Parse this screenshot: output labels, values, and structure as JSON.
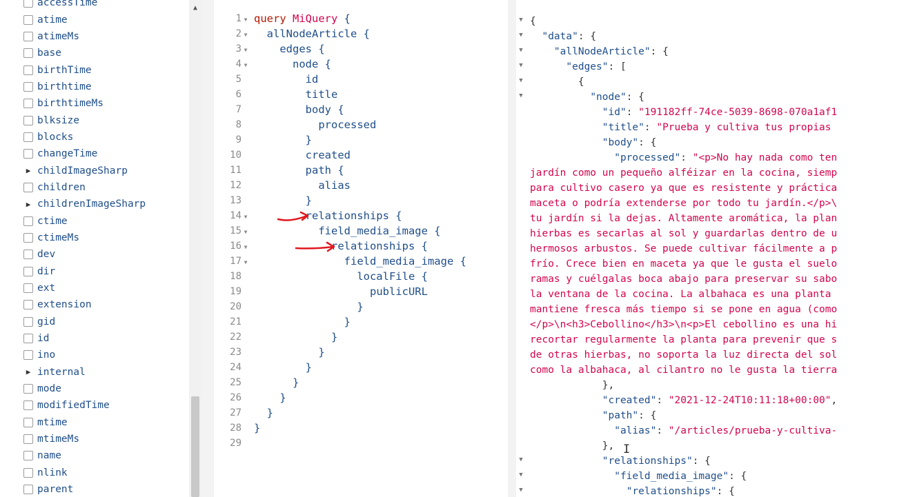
{
  "explorer": {
    "fields": [
      {
        "label": "accessTime",
        "expandable": false
      },
      {
        "label": "atime",
        "expandable": false
      },
      {
        "label": "atimeMs",
        "expandable": false
      },
      {
        "label": "base",
        "expandable": false
      },
      {
        "label": "birthTime",
        "expandable": false
      },
      {
        "label": "birthtime",
        "expandable": false
      },
      {
        "label": "birthtimeMs",
        "expandable": false
      },
      {
        "label": "blksize",
        "expandable": false
      },
      {
        "label": "blocks",
        "expandable": false
      },
      {
        "label": "changeTime",
        "expandable": false
      },
      {
        "label": "childImageSharp",
        "expandable": true
      },
      {
        "label": "children",
        "expandable": false
      },
      {
        "label": "childrenImageSharp",
        "expandable": true
      },
      {
        "label": "ctime",
        "expandable": false
      },
      {
        "label": "ctimeMs",
        "expandable": false
      },
      {
        "label": "dev",
        "expandable": false
      },
      {
        "label": "dir",
        "expandable": false
      },
      {
        "label": "ext",
        "expandable": false
      },
      {
        "label": "extension",
        "expandable": false
      },
      {
        "label": "gid",
        "expandable": false
      },
      {
        "label": "id",
        "expandable": false
      },
      {
        "label": "ino",
        "expandable": false
      },
      {
        "label": "internal",
        "expandable": true
      },
      {
        "label": "mode",
        "expandable": false
      },
      {
        "label": "modifiedTime",
        "expandable": false
      },
      {
        "label": "mtime",
        "expandable": false
      },
      {
        "label": "mtimeMs",
        "expandable": false
      },
      {
        "label": "name",
        "expandable": false
      },
      {
        "label": "nlink",
        "expandable": false
      },
      {
        "label": "parent",
        "expandable": false
      }
    ]
  },
  "query": {
    "line_numbers": [
      "1",
      "2",
      "3",
      "4",
      "5",
      "6",
      "7",
      "8",
      "9",
      "10",
      "11",
      "12",
      "13",
      "14",
      "15",
      "16",
      "17",
      "18",
      "19",
      "20",
      "21",
      "22",
      "23",
      "24",
      "25",
      "26",
      "27",
      "28",
      "29"
    ],
    "lines": [
      {
        "indent": "",
        "parts": [
          {
            "t": "query ",
            "c": "kw"
          },
          {
            "t": "MiQuery",
            "c": "op"
          },
          {
            "t": " {",
            "c": ""
          }
        ]
      },
      {
        "indent": "  ",
        "parts": [
          {
            "t": "allNodeArticle {",
            "c": ""
          }
        ]
      },
      {
        "indent": "    ",
        "parts": [
          {
            "t": "edges {",
            "c": ""
          }
        ]
      },
      {
        "indent": "      ",
        "parts": [
          {
            "t": "node {",
            "c": ""
          }
        ]
      },
      {
        "indent": "        ",
        "parts": [
          {
            "t": "id",
            "c": ""
          }
        ]
      },
      {
        "indent": "        ",
        "parts": [
          {
            "t": "title",
            "c": ""
          }
        ]
      },
      {
        "indent": "        ",
        "parts": [
          {
            "t": "body {",
            "c": ""
          }
        ]
      },
      {
        "indent": "          ",
        "parts": [
          {
            "t": "processed",
            "c": ""
          }
        ]
      },
      {
        "indent": "        ",
        "parts": [
          {
            "t": "}",
            "c": ""
          }
        ]
      },
      {
        "indent": "        ",
        "parts": [
          {
            "t": "created",
            "c": ""
          }
        ]
      },
      {
        "indent": "        ",
        "parts": [
          {
            "t": "path {",
            "c": ""
          }
        ]
      },
      {
        "indent": "          ",
        "parts": [
          {
            "t": "alias",
            "c": ""
          }
        ]
      },
      {
        "indent": "        ",
        "parts": [
          {
            "t": "}",
            "c": ""
          }
        ]
      },
      {
        "indent": "        ",
        "parts": [
          {
            "t": "relationships {",
            "c": ""
          }
        ]
      },
      {
        "indent": "          ",
        "parts": [
          {
            "t": "field_media_image {",
            "c": ""
          }
        ]
      },
      {
        "indent": "            ",
        "parts": [
          {
            "t": "relationships {",
            "c": ""
          }
        ]
      },
      {
        "indent": "              ",
        "parts": [
          {
            "t": "field_media_image {",
            "c": ""
          }
        ]
      },
      {
        "indent": "                ",
        "parts": [
          {
            "t": "localFile {",
            "c": ""
          }
        ]
      },
      {
        "indent": "                  ",
        "parts": [
          {
            "t": "publicURL",
            "c": ""
          }
        ]
      },
      {
        "indent": "                ",
        "parts": [
          {
            "t": "}",
            "c": ""
          }
        ]
      },
      {
        "indent": "              ",
        "parts": [
          {
            "t": "}",
            "c": ""
          }
        ]
      },
      {
        "indent": "            ",
        "parts": [
          {
            "t": "}",
            "c": ""
          }
        ]
      },
      {
        "indent": "          ",
        "parts": [
          {
            "t": "}",
            "c": ""
          }
        ]
      },
      {
        "indent": "        ",
        "parts": [
          {
            "t": "}",
            "c": ""
          }
        ]
      },
      {
        "indent": "      ",
        "parts": [
          {
            "t": "}",
            "c": ""
          }
        ]
      },
      {
        "indent": "    ",
        "parts": [
          {
            "t": "}",
            "c": ""
          }
        ]
      },
      {
        "indent": "  ",
        "parts": [
          {
            "t": "}",
            "c": ""
          }
        ]
      },
      {
        "indent": "",
        "parts": [
          {
            "t": "}",
            "c": ""
          }
        ]
      },
      {
        "indent": "",
        "parts": []
      }
    ],
    "fold_lines": [
      "1",
      "2",
      "3",
      "4",
      "14",
      "15",
      "16",
      "17"
    ],
    "annotated_lines": [
      "14",
      "16"
    ]
  },
  "result": {
    "lines": [
      {
        "indent": "",
        "parts": [
          {
            "t": "{",
            "c": "p"
          }
        ]
      },
      {
        "indent": "  ",
        "parts": [
          {
            "t": "\"data\"",
            "c": "k"
          },
          {
            "t": ": {",
            "c": "p"
          }
        ]
      },
      {
        "indent": "    ",
        "parts": [
          {
            "t": "\"allNodeArticle\"",
            "c": "k"
          },
          {
            "t": ": {",
            "c": "p"
          }
        ]
      },
      {
        "indent": "      ",
        "parts": [
          {
            "t": "\"edges\"",
            "c": "k"
          },
          {
            "t": ": [",
            "c": "p"
          }
        ]
      },
      {
        "indent": "        ",
        "parts": [
          {
            "t": "{",
            "c": "p"
          }
        ]
      },
      {
        "indent": "          ",
        "parts": [
          {
            "t": "\"node\"",
            "c": "k"
          },
          {
            "t": ": {",
            "c": "p"
          }
        ]
      },
      {
        "indent": "            ",
        "parts": [
          {
            "t": "\"id\"",
            "c": "k"
          },
          {
            "t": ": ",
            "c": "p"
          },
          {
            "t": "\"191182ff-74ce-5039-8698-070a1af1",
            "c": "s"
          }
        ]
      },
      {
        "indent": "            ",
        "parts": [
          {
            "t": "\"title\"",
            "c": "k"
          },
          {
            "t": ": ",
            "c": "p"
          },
          {
            "t": "\"Prueba y cultiva tus propias",
            "c": "s"
          }
        ]
      },
      {
        "indent": "            ",
        "parts": [
          {
            "t": "\"body\"",
            "c": "k"
          },
          {
            "t": ": {",
            "c": "p"
          }
        ]
      },
      {
        "indent": "              ",
        "parts": [
          {
            "t": "\"processed\"",
            "c": "k"
          },
          {
            "t": ": ",
            "c": "p"
          },
          {
            "t": "\"<p>No hay nada como ten",
            "c": "s"
          }
        ]
      },
      {
        "indent": "",
        "parts": [
          {
            "t": "jardín como un pequeño alféizar en la cocina, siemp",
            "c": "s"
          }
        ]
      },
      {
        "indent": "",
        "parts": [
          {
            "t": "para cultivo casero ya que es resistente y práctica",
            "c": "s"
          }
        ]
      },
      {
        "indent": "",
        "parts": [
          {
            "t": "maceta o podría extenderse por todo tu jardín.</p>\\",
            "c": "s"
          }
        ]
      },
      {
        "indent": "",
        "parts": [
          {
            "t": "tu jardín si la dejas. Altamente aromática, la plan",
            "c": "s"
          }
        ]
      },
      {
        "indent": "",
        "parts": [
          {
            "t": "hierbas es secarlas al sol y guardarlas dentro de u",
            "c": "s"
          }
        ]
      },
      {
        "indent": "",
        "parts": [
          {
            "t": "hermosos arbustos. Se puede cultivar fácilmente a p",
            "c": "s"
          }
        ]
      },
      {
        "indent": "",
        "parts": [
          {
            "t": "frío. Crece bien en maceta ya que le gusta el suelo",
            "c": "s"
          }
        ]
      },
      {
        "indent": "",
        "parts": [
          {
            "t": "ramas y cuélgalas boca abajo para preservar su sabo",
            "c": "s"
          }
        ]
      },
      {
        "indent": "",
        "parts": [
          {
            "t": "la ventana de la cocina. La albahaca es una planta ",
            "c": "s"
          }
        ]
      },
      {
        "indent": "",
        "parts": [
          {
            "t": "mantiene fresca más tiempo si se pone en agua (como",
            "c": "s"
          }
        ]
      },
      {
        "indent": "",
        "parts": [
          {
            "t": "</p>\\n<h3>Cebollino</h3>\\n<p>El cebollino es una hi",
            "c": "s"
          }
        ]
      },
      {
        "indent": "",
        "parts": [
          {
            "t": "recortar regularmente la planta para prevenir que s",
            "c": "s"
          }
        ]
      },
      {
        "indent": "",
        "parts": [
          {
            "t": "de otras hierbas, no soporta la luz directa del sol",
            "c": "s"
          }
        ]
      },
      {
        "indent": "",
        "parts": [
          {
            "t": "como la albahaca, al cilantro no le gusta la tierra",
            "c": "s"
          }
        ]
      },
      {
        "indent": "            ",
        "parts": [
          {
            "t": "},",
            "c": "p"
          }
        ]
      },
      {
        "indent": "            ",
        "parts": [
          {
            "t": "\"created\"",
            "c": "k"
          },
          {
            "t": ": ",
            "c": "p"
          },
          {
            "t": "\"2021-12-24T10:11:18+00:00\"",
            "c": "s"
          },
          {
            "t": ",",
            "c": "p"
          }
        ]
      },
      {
        "indent": "            ",
        "parts": [
          {
            "t": "\"path\"",
            "c": "k"
          },
          {
            "t": ": {",
            "c": "p"
          }
        ]
      },
      {
        "indent": "              ",
        "parts": [
          {
            "t": "\"alias\"",
            "c": "k"
          },
          {
            "t": ": ",
            "c": "p"
          },
          {
            "t": "\"/articles/prueba-y-cultiva-",
            "c": "s"
          }
        ]
      },
      {
        "indent": "            ",
        "parts": [
          {
            "t": "},",
            "c": "p"
          }
        ]
      },
      {
        "indent": "            ",
        "parts": [
          {
            "t": "\"relationships\"",
            "c": "k"
          },
          {
            "t": ": {",
            "c": "p"
          }
        ]
      },
      {
        "indent": "              ",
        "parts": [
          {
            "t": "\"field_media_image\"",
            "c": "k"
          },
          {
            "t": ": {",
            "c": "p"
          }
        ]
      },
      {
        "indent": "                ",
        "parts": [
          {
            "t": "\"relationships\"",
            "c": "k"
          },
          {
            "t": ": {",
            "c": "p"
          }
        ]
      }
    ],
    "fold_lines": [
      "1",
      "2",
      "3",
      "4",
      "5",
      "6",
      "30",
      "31",
      "32"
    ]
  },
  "colors": {
    "field_name": "#1f4e8a",
    "keyword": "#b11a04",
    "string": "#d2054e",
    "annotation_arrow": "#e0171f"
  },
  "icons": {
    "expand": "triangle-right-icon",
    "checkbox": "checkbox-icon",
    "fold": "fold-caret-icon",
    "scroll_up": "scroll-up-arrow-icon"
  }
}
